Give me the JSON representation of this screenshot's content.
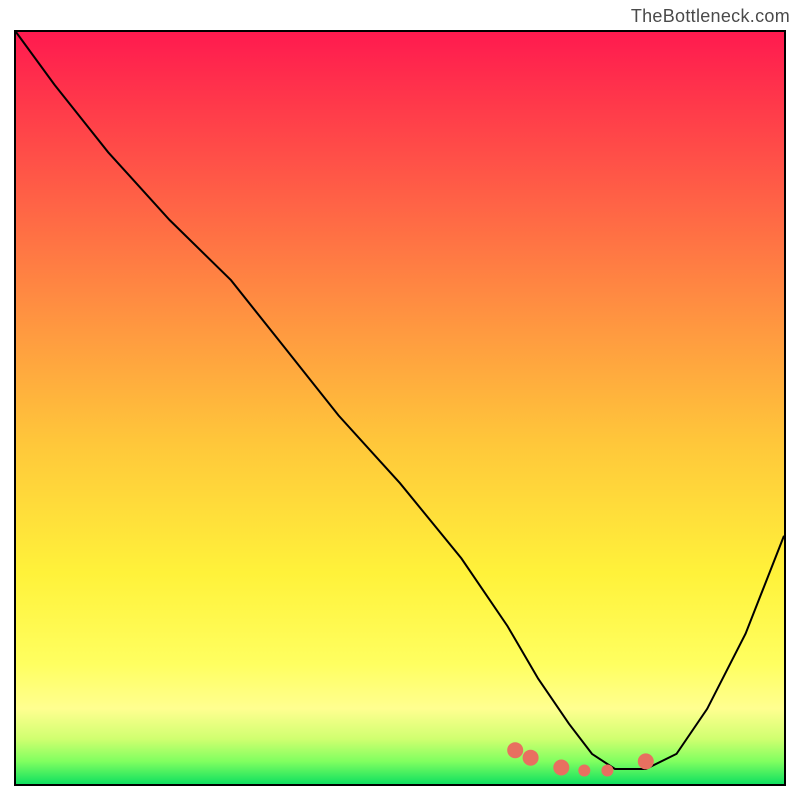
{
  "watermark": "TheBottleneck.com",
  "chart_data": {
    "type": "line",
    "title": "",
    "xlabel": "",
    "ylabel": "",
    "xlim": [
      0,
      100
    ],
    "ylim": [
      0,
      100
    ],
    "series": [
      {
        "name": "curve",
        "color": "#000000",
        "x": [
          0,
          5,
          12,
          20,
          28,
          35,
          42,
          50,
          58,
          64,
          68,
          72,
          75,
          78,
          82,
          86,
          90,
          95,
          100
        ],
        "y": [
          100,
          93,
          84,
          75,
          67,
          58,
          49,
          40,
          30,
          21,
          14,
          8,
          4,
          2,
          2,
          4,
          10,
          20,
          33
        ]
      }
    ],
    "points": [
      {
        "name": "cluster-a",
        "x": 65,
        "y": 4.5,
        "color": "#e87060",
        "r": 4
      },
      {
        "name": "cluster-b",
        "x": 67,
        "y": 3.5,
        "color": "#e87060",
        "r": 4
      },
      {
        "name": "cluster-c",
        "x": 71,
        "y": 2.2,
        "color": "#e87060",
        "r": 4
      },
      {
        "name": "cluster-d",
        "x": 74,
        "y": 1.8,
        "color": "#e87060",
        "r": 3
      },
      {
        "name": "cluster-e",
        "x": 77,
        "y": 1.8,
        "color": "#e87060",
        "r": 3
      },
      {
        "name": "cluster-f",
        "x": 82,
        "y": 3.0,
        "color": "#e87060",
        "r": 4
      }
    ],
    "grid": false,
    "legend": false
  }
}
